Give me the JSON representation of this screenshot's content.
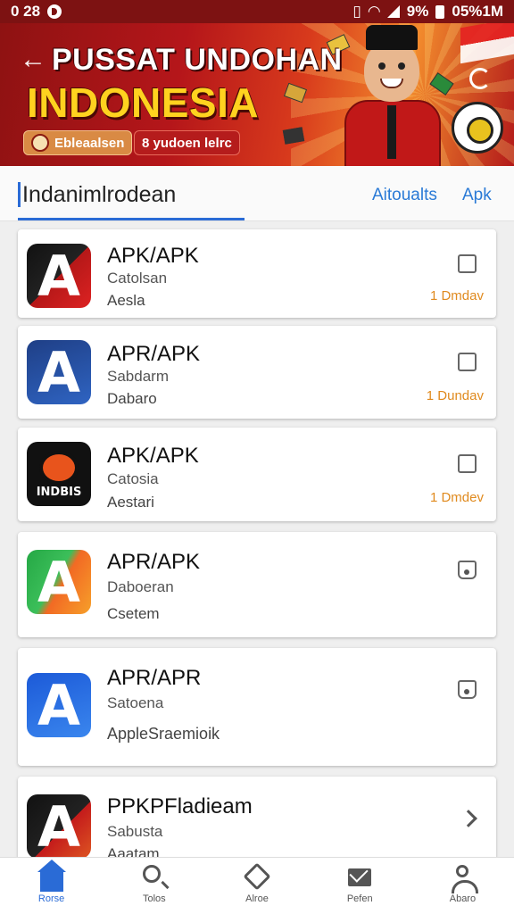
{
  "status_bar": {
    "time": "0 28",
    "battery_text": "9%",
    "right_text": "05%1M"
  },
  "banner": {
    "title": "PUSSAT UNDOHAN",
    "subtitle": "INDONESIA",
    "chip1": "Ebleaalsen",
    "chip2": "8 yudoen lelrc",
    "colors": {
      "background": "#b5161a",
      "subtitle": "#ffd21f"
    }
  },
  "header": {
    "tab_main": "Indanimlrodean",
    "link1": "Aitoualts",
    "link2": "Apk",
    "accent": "#2a6bd6"
  },
  "apps": [
    {
      "name": "APK/APK",
      "line1": "Catolsan",
      "line2": "Aesla",
      "duration": "1 Dmdav",
      "icon_letter": "A",
      "control": "checkbox"
    },
    {
      "name": "APR/APK",
      "line1": "Sabdarm",
      "line2": "Dabaro",
      "duration": "1 Dundav",
      "icon_letter": "A",
      "control": "checkbox"
    },
    {
      "name": "APK/APK",
      "line1": "Catosia",
      "line2": "Aestari",
      "duration": "1 Dmdev",
      "icon_letter": "INDBIS",
      "control": "checkbox"
    },
    {
      "name": "APR/APK",
      "line1": "Daboeran",
      "line2": "Csetem",
      "duration": "",
      "icon_letter": "A",
      "control": "checkbox-dot"
    },
    {
      "name": "APR/APR",
      "line1": "Satoena",
      "line2": "AppleSraemioik",
      "duration": "",
      "icon_letter": "A",
      "control": "checkbox-dot"
    },
    {
      "name": "PPKPFladieam",
      "line1": "Sabusta",
      "line2": "Aaatam",
      "duration": "",
      "icon_letter": "A",
      "control": "chevron"
    }
  ],
  "bottom_nav": [
    {
      "label": "Rorse",
      "icon": "home-icon",
      "active": true
    },
    {
      "label": "Tolos",
      "icon": "search-icon",
      "active": false
    },
    {
      "label": "Alroe",
      "icon": "house-outline-icon",
      "active": false
    },
    {
      "label": "Pefen",
      "icon": "mail-icon",
      "active": false
    },
    {
      "label": "Abaro",
      "icon": "user-icon",
      "active": false
    }
  ]
}
